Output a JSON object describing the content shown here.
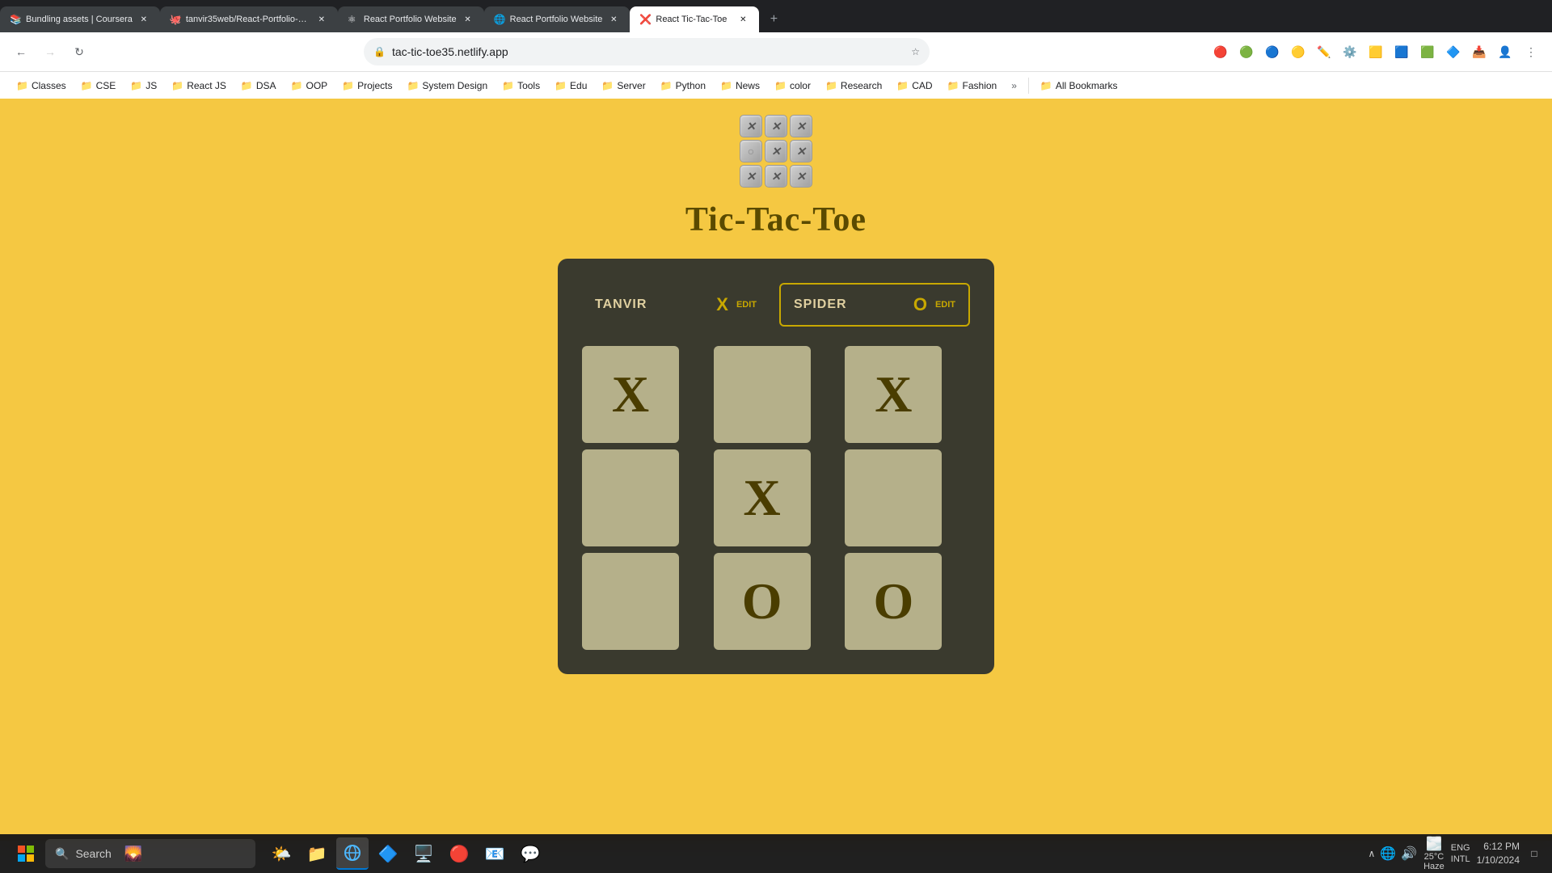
{
  "browser": {
    "tabs": [
      {
        "id": "tab-1",
        "title": "Bundling assets | Coursera",
        "favicon": "📚",
        "active": false
      },
      {
        "id": "tab-2",
        "title": "tanvir35web/React-Portfolio-W...",
        "favicon": "🐙",
        "active": false
      },
      {
        "id": "tab-3",
        "title": "React Portfolio Website",
        "favicon": "⚛",
        "active": false
      },
      {
        "id": "tab-4",
        "title": "React Portfolio Website",
        "favicon": "🌐",
        "active": false
      },
      {
        "id": "tab-5",
        "title": "React Tic-Tac-Toe",
        "favicon": "❌",
        "active": true
      }
    ],
    "url": "tac-tic-toe35.netlify.app",
    "nav_buttons": {
      "back": "←",
      "forward": "→",
      "refresh": "↻",
      "home": "⌂"
    }
  },
  "bookmarks": [
    {
      "label": "Classes",
      "icon": "📁"
    },
    {
      "label": "CSE",
      "icon": "📁"
    },
    {
      "label": "JS",
      "icon": "📁"
    },
    {
      "label": "React JS",
      "icon": "📁"
    },
    {
      "label": "DSA",
      "icon": "📁"
    },
    {
      "label": "OOP",
      "icon": "📁"
    },
    {
      "label": "Projects",
      "icon": "📁"
    },
    {
      "label": "System Design",
      "icon": "📁"
    },
    {
      "label": "Tools",
      "icon": "📁"
    },
    {
      "label": "Edu",
      "icon": "📁"
    },
    {
      "label": "Server",
      "icon": "📁"
    },
    {
      "label": "Python",
      "icon": "📁"
    },
    {
      "label": "News",
      "icon": "📁"
    },
    {
      "label": "color",
      "icon": "📁"
    },
    {
      "label": "Research",
      "icon": "📁"
    },
    {
      "label": "CAD",
      "icon": "📁"
    },
    {
      "label": "Fashion",
      "icon": "📁"
    },
    {
      "label": "»",
      "icon": ""
    },
    {
      "label": "All Bookmarks",
      "icon": "📁"
    }
  ],
  "game": {
    "title": "Tic-Tac-Toe",
    "logo_cells": [
      "✕",
      "✕",
      "✕",
      "○",
      "✕",
      "✕",
      "✕",
      "✕",
      "✕"
    ],
    "player1": {
      "name": "TANVIR",
      "symbol": "X",
      "edit_label": "EDIT",
      "active": false
    },
    "player2": {
      "name": "SPIDER",
      "symbol": "O",
      "edit_label": "EDIT",
      "active": true
    },
    "board": [
      {
        "value": "X",
        "row": 0,
        "col": 0
      },
      {
        "value": "",
        "row": 0,
        "col": 1
      },
      {
        "value": "X",
        "row": 0,
        "col": 2
      },
      {
        "value": "",
        "row": 1,
        "col": 0
      },
      {
        "value": "X",
        "row": 1,
        "col": 1
      },
      {
        "value": "",
        "row": 1,
        "col": 2
      },
      {
        "value": "",
        "row": 2,
        "col": 0
      },
      {
        "value": "O",
        "row": 2,
        "col": 1
      },
      {
        "value": "O",
        "row": 2,
        "col": 2
      }
    ]
  },
  "taskbar": {
    "search_placeholder": "Search",
    "weather": "25°C",
    "weather_desc": "Haze",
    "time": "6:12 PM",
    "date": "1/10/2024",
    "language": "ENG",
    "input_method": "INTL"
  }
}
